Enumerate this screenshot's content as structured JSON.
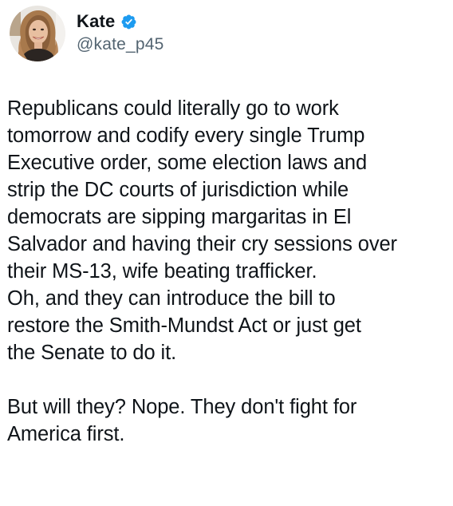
{
  "tweet": {
    "author": {
      "name": "Kate",
      "handle": "@kate_p45",
      "verified": true,
      "verified_color": "#1d9bf0",
      "avatar_icon": "profile-photo"
    },
    "text_lines": [
      "Republicans could literally go to work",
      "tomorrow and codify every single Trump",
      "Executive order, some election laws and",
      "strip the DC courts of jurisdiction while",
      "democrats are sipping margaritas in El",
      "Salvador and having their cry sessions over",
      "their MS-13, wife beating trafficker.",
      "Oh, and they can introduce the bill to",
      "restore the Smith-Mundst Act or just get",
      "the Senate to do it.",
      "",
      "But will they? Nope. They don't fight for",
      "America first."
    ]
  }
}
